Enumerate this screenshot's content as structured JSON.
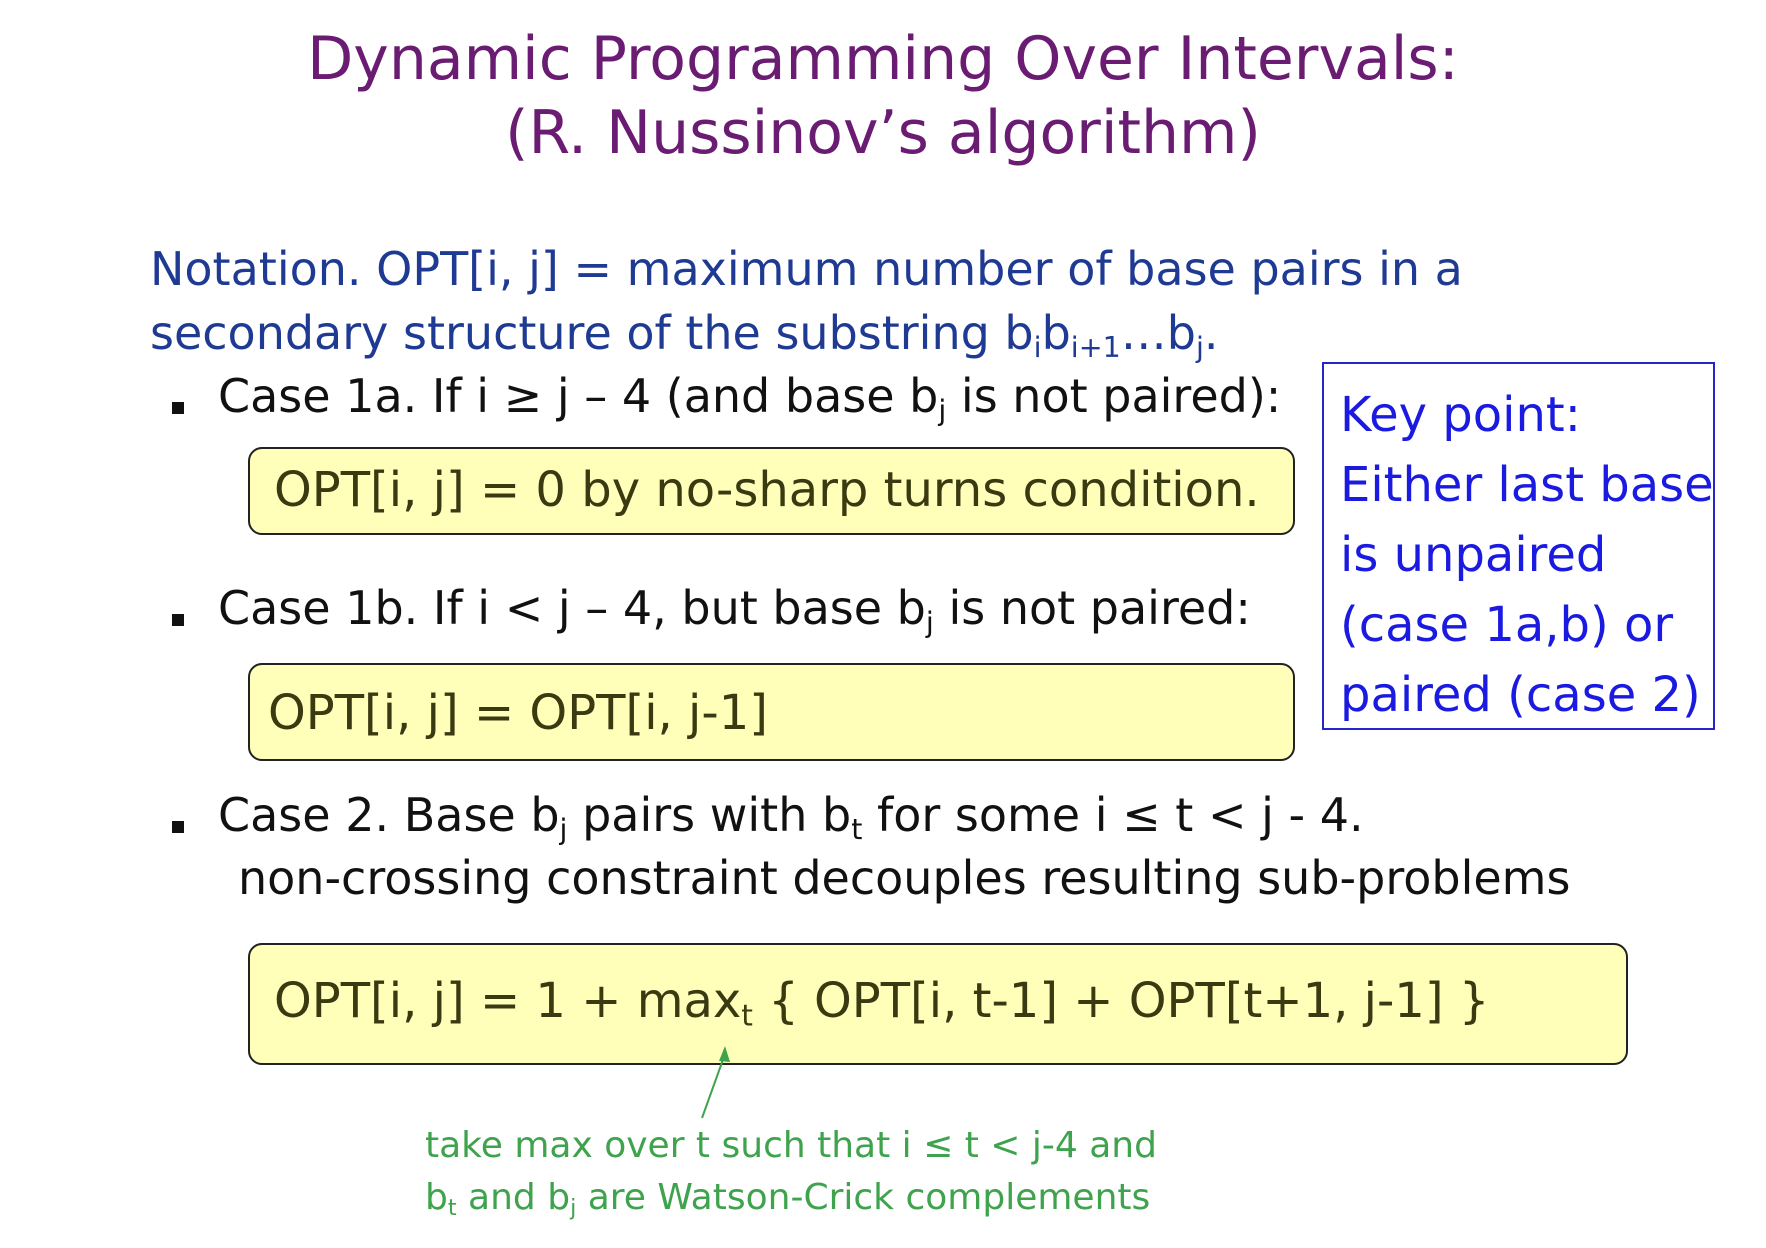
{
  "title": {
    "line1": "Dynamic Programming Over Intervals:",
    "line2": "(R. Nussinov’s algorithm)"
  },
  "notation": {
    "line1": "Notation.  OPT[i, j] = maximum number of base pairs in a",
    "line2_prefix": "secondary structure of the substring  b",
    "line2_sub1": "i",
    "line2_b2": "b",
    "line2_sub2": "i+1",
    "line2_ellipsis": "…b",
    "line2_sub3": "j",
    "line2_end": "."
  },
  "case1a": {
    "text_before": "Case 1a. If i ≥ j – 4 (and base b",
    "sub": "j",
    "text_after": " is not paired):",
    "formula": "OPT[i, j] = 0 by no-sharp turns condition."
  },
  "case1b": {
    "text_before": "Case 1b. If i < j – 4, but base b",
    "sub": "j",
    "text_after": " is not paired:",
    "formula": "OPT[i, j] = OPT[i, j-1]"
  },
  "case2": {
    "text_a": "Case 2.  Base b",
    "sub_a": "j",
    "text_b": " pairs with b",
    "sub_b": "t",
    "text_c": " for some i ≤ t < j - 4.",
    "line2": "non-crossing constraint decouples resulting sub-problems",
    "formula_before": "OPT[i, j] = 1 + max",
    "formula_sub": "t",
    "formula_after": " { OPT[i, t-1] + OPT[t+1, j-1]  }"
  },
  "key_point": {
    "lines": [
      "Key point:",
      "Either last base",
      "is unpaired",
      "(case 1a,b) or",
      "paired (case 2)"
    ]
  },
  "note": {
    "line1": "take max over t such that i ≤ t < j-4 and",
    "line2_a": "b",
    "line2_sub_a": "t",
    "line2_b": " and b",
    "line2_sub_b": "j",
    "line2_c": " are Watson-Crick complements"
  },
  "colors": {
    "title": "#6a1b72",
    "notation": "#1f3a93",
    "formula_box_fill": "#ffffb9",
    "key_point": "#1a1ae0",
    "note": "#3fa34d"
  }
}
